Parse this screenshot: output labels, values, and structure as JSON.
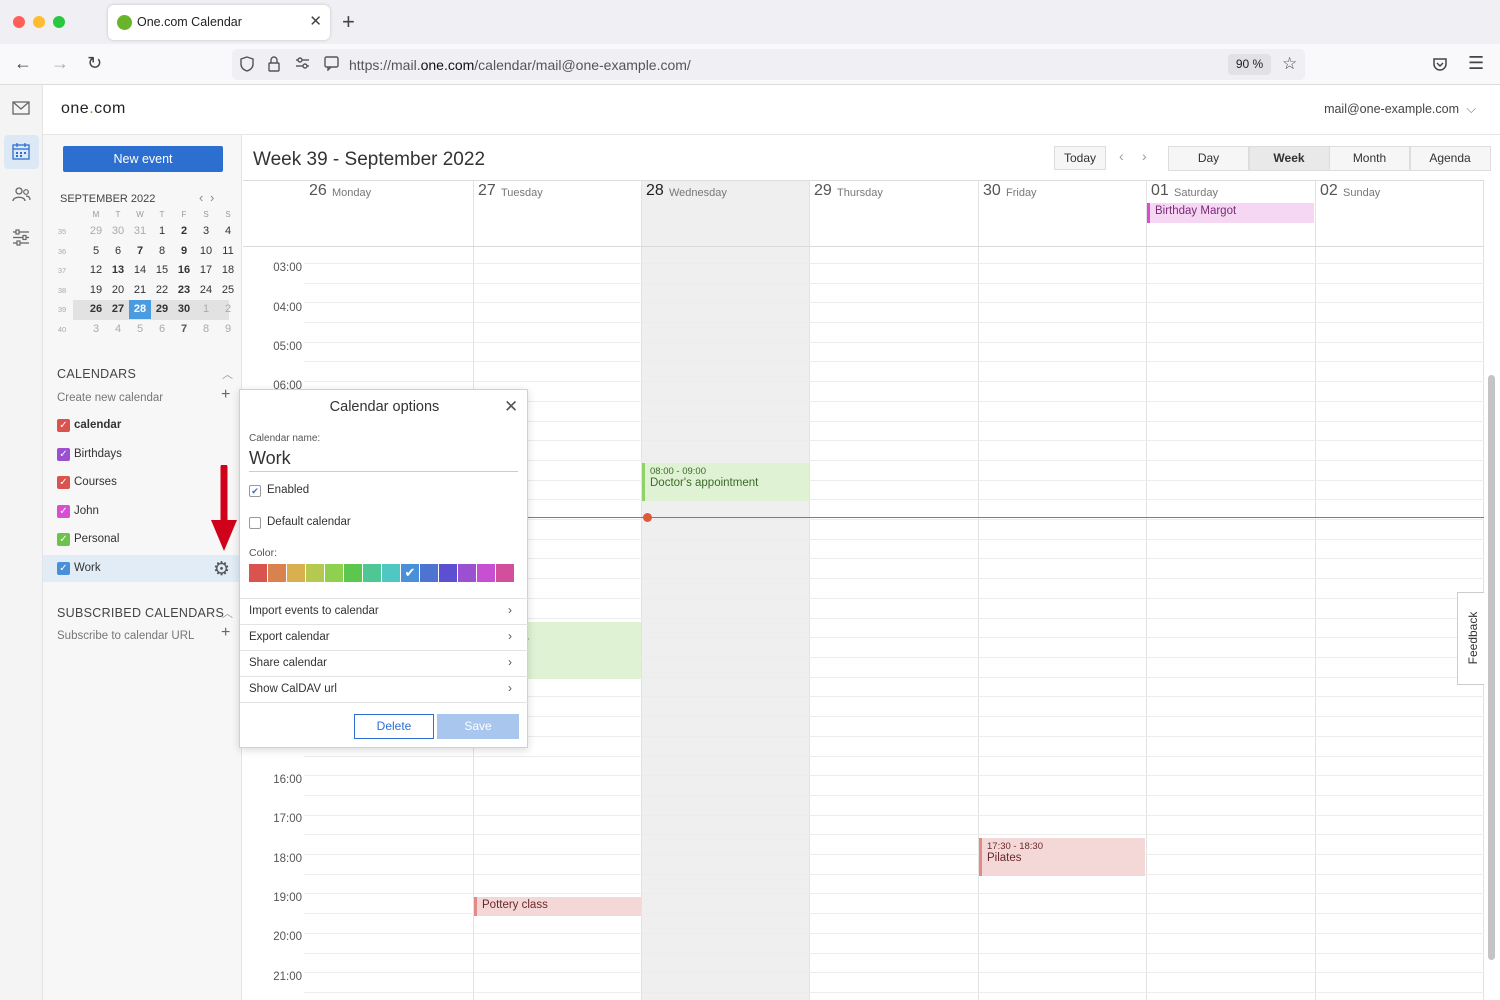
{
  "browser": {
    "tab_title": "One.com Calendar",
    "url_prefix": "https://mail.",
    "url_domain": "one.com",
    "url_suffix": "/calendar/mail@one-example.com/",
    "zoom": "90 %"
  },
  "header": {
    "logo_a": "one",
    "logo_dot": ".",
    "logo_b": "com",
    "account": "mail@one-example.com"
  },
  "sidebar": {
    "new_event": "New event",
    "mini_title": "SEPTEMBER 2022",
    "weekday_heads": [
      "M",
      "T",
      "W",
      "T",
      "F",
      "S",
      "S"
    ],
    "weeks": [
      {
        "wk": "35",
        "days": [
          "29",
          "30",
          "31",
          "1",
          "2",
          "3",
          "4"
        ]
      },
      {
        "wk": "36",
        "days": [
          "5",
          "6",
          "7",
          "8",
          "9",
          "10",
          "11"
        ]
      },
      {
        "wk": "37",
        "days": [
          "12",
          "13",
          "14",
          "15",
          "16",
          "17",
          "18"
        ]
      },
      {
        "wk": "38",
        "days": [
          "19",
          "20",
          "21",
          "22",
          "23",
          "24",
          "25"
        ]
      },
      {
        "wk": "39",
        "days": [
          "26",
          "27",
          "28",
          "29",
          "30",
          "1",
          "2"
        ]
      },
      {
        "wk": "40",
        "days": [
          "3",
          "4",
          "5",
          "6",
          "7",
          "8",
          "9"
        ]
      }
    ],
    "calendars_title": "CALENDARS",
    "create_new": "Create new calendar",
    "calendars": [
      {
        "label": "calendar",
        "color": "#d9534f"
      },
      {
        "label": "Birthdays",
        "color": "#9b4fd1"
      },
      {
        "label": "Courses",
        "color": "#d9534f"
      },
      {
        "label": "John",
        "color": "#d64fd1"
      },
      {
        "label": "Personal",
        "color": "#6cc24a"
      },
      {
        "label": "Work",
        "color": "#4a90d9"
      }
    ],
    "subscribed_title": "SUBSCRIBED CALENDARS",
    "subscribe_url": "Subscribe to calendar URL"
  },
  "main": {
    "title": "Week 39 - September 2022",
    "today": "Today",
    "views": [
      "Day",
      "Week",
      "Month",
      "Agenda"
    ],
    "active_view": "Week",
    "days": [
      {
        "num": "26",
        "name": "Monday"
      },
      {
        "num": "27",
        "name": "Tuesday"
      },
      {
        "num": "28",
        "name": "Wednesday"
      },
      {
        "num": "29",
        "name": "Thursday"
      },
      {
        "num": "30",
        "name": "Friday"
      },
      {
        "num": "01",
        "name": "Saturday"
      },
      {
        "num": "02",
        "name": "Sunday"
      }
    ],
    "times": [
      "03:00",
      "04:00",
      "05:00",
      "06:00",
      "16:00",
      "17:00",
      "18:00",
      "19:00",
      "20:00",
      "21:00"
    ],
    "events": {
      "birthday": "Birthday Margot",
      "doctor_time": "08:00  -  09:00",
      "doctor_title": "Doctor's appointment",
      "partial_time": "30",
      "partial_title": "ser",
      "pilates_time": "17:30  -  18:30",
      "pilates_title": "Pilates",
      "pottery_title": "Pottery class"
    },
    "feedback": "Feedback"
  },
  "popup": {
    "title": "Calendar options",
    "name_label": "Calendar name:",
    "name_value": "Work",
    "enabled": "Enabled",
    "default": "Default calendar",
    "color_label": "Color:",
    "colors": [
      "#d9534f",
      "#d9824f",
      "#d9b04f",
      "#b5c94f",
      "#8fd14f",
      "#5cc74f",
      "#4fc795",
      "#4fc7c2",
      "#4a90d9",
      "#4f73d1",
      "#5d4fd1",
      "#9b4fd1",
      "#c74fd1",
      "#d14f9b"
    ],
    "rows": [
      "Import events to calendar",
      "Export calendar",
      "Share calendar",
      "Show CalDAV url"
    ],
    "delete": "Delete",
    "save": "Save"
  }
}
